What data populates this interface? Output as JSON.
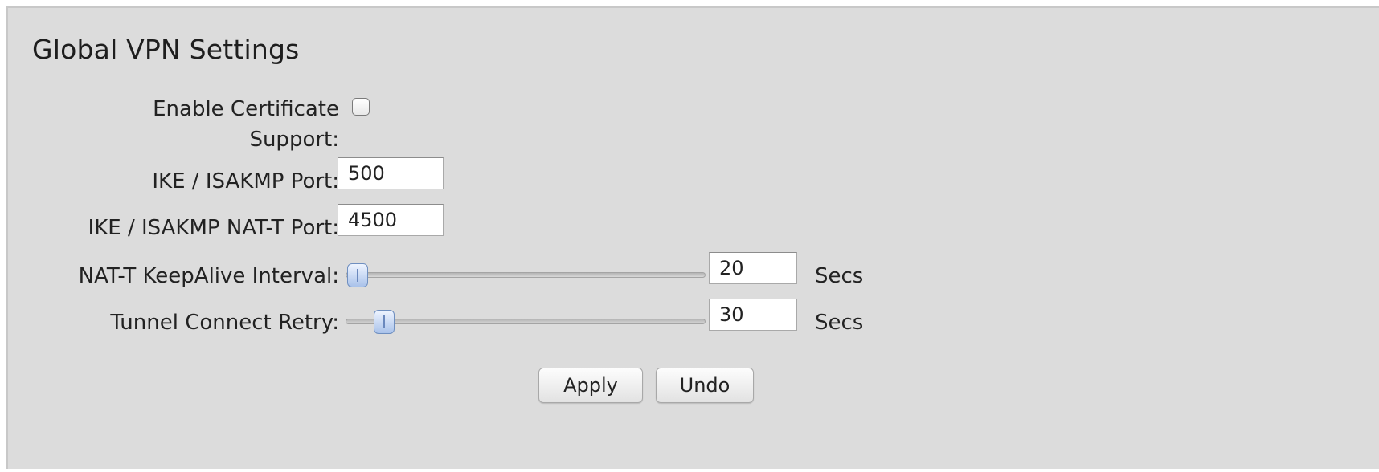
{
  "section": {
    "title": "Global VPN Settings"
  },
  "fields": {
    "certificate": {
      "label_line1": "Enable Certificate",
      "label_line2": "Support:",
      "checked": false
    },
    "ike_port": {
      "label": "IKE / ISAKMP Port:",
      "value": "500"
    },
    "nat_t_port": {
      "label": "IKE / ISAKMP NAT-T Port:",
      "value": "4500"
    },
    "keepalive": {
      "label": "NAT-T KeepAlive Interval:",
      "value": "20",
      "unit": "Secs"
    },
    "retry": {
      "label": "Tunnel Connect Retry:",
      "value": "30",
      "unit": "Secs"
    }
  },
  "buttons": {
    "apply": "Apply",
    "undo": "Undo"
  },
  "colors": {
    "panel_background": "#dcdcdc",
    "slider_thumb": "#a9c2ea"
  }
}
